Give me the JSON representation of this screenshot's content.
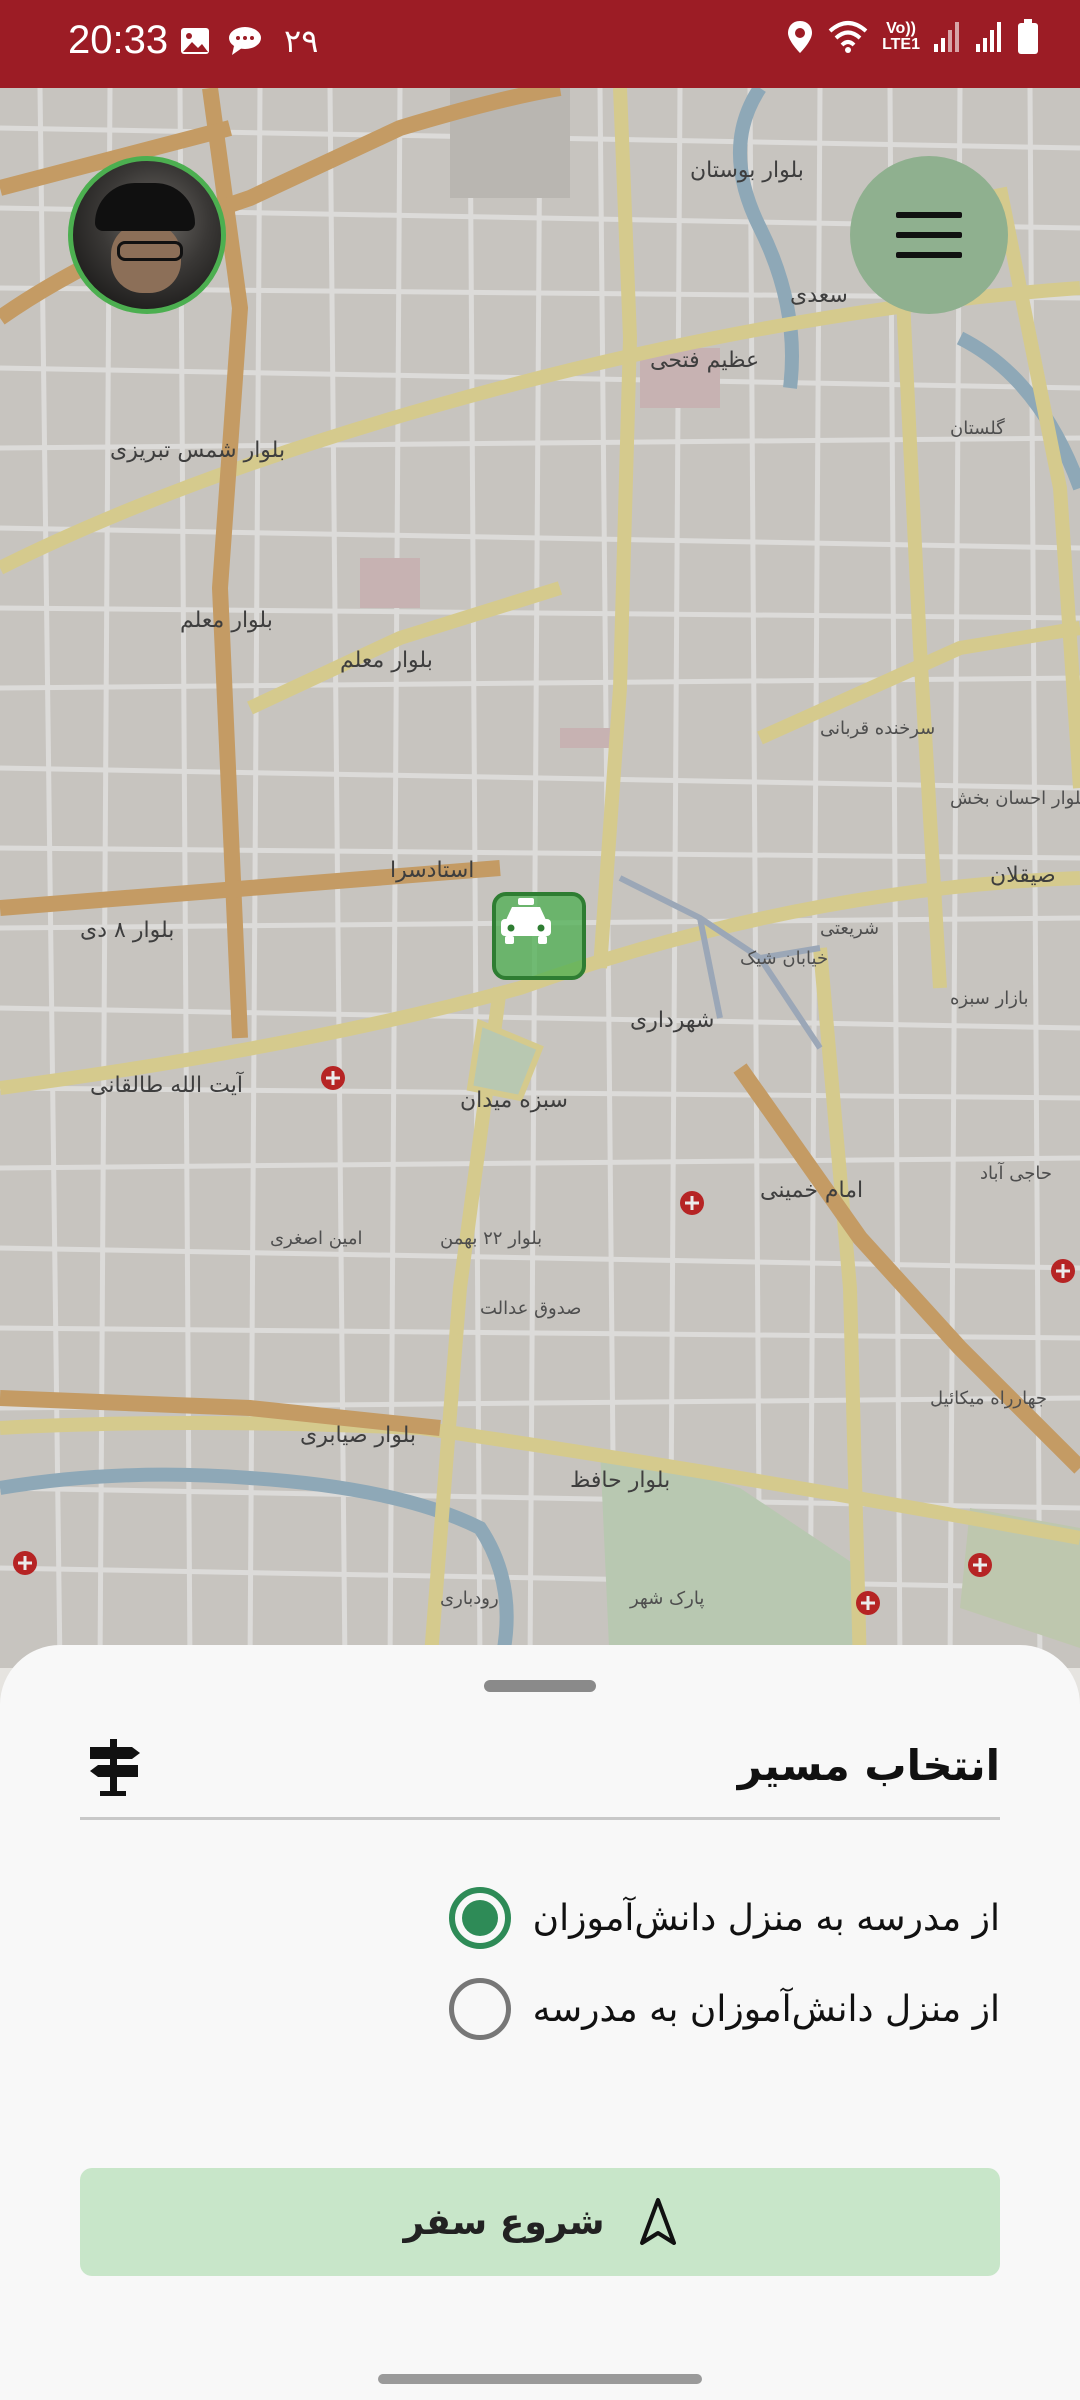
{
  "status_bar": {
    "time": "20:33",
    "notification_count": "۲۹",
    "network_label_top": "Vo))",
    "network_label_bottom": "LTE1",
    "background_color": "#9c1c25"
  },
  "map": {
    "labels": [
      "بلوار معلم",
      "بلوار شمس تبریزی",
      "بلوار ۸ دی",
      "آیت الله طالقانی",
      "سعدی",
      "عظیم فتحی",
      "بلوار بوستان",
      "سرخنده قربانی",
      "بلوار احسان بخش",
      "صیقلان",
      "شهرداری",
      "سبزه میدان",
      "بلوار ۲۲ بهمن",
      "امام خمینی",
      "بلوار حافظ",
      "بلوار صیابری",
      "پارک شهر",
      "رودباری",
      "گلستان",
      "خیابان شیک",
      "شریعتی",
      "استادسرا",
      "بلوار معلم",
      "جهارراه میکائیل",
      "امین اصغری",
      "صدوق عدالت",
      "بازار سبزه",
      "حاجی آباد"
    ],
    "icons": [
      "taxi-marker-icon"
    ],
    "accent_color": "#4caf50"
  },
  "menu": {
    "icon": "hamburger-menu-icon"
  },
  "sheet": {
    "title": "انتخاب مسیر",
    "title_icon": "signpost-icon",
    "options": [
      {
        "label": "از مدرسه به منزل دانش‌آموزان",
        "selected": true
      },
      {
        "label": "از منزل دانش‌آموزان به مدرسه",
        "selected": false
      }
    ],
    "start_button_label": "شروع سفر",
    "start_button_icon": "navigation-arrow-icon",
    "start_button_color": "#c8e6c9",
    "radio_color": "#2e8b57"
  }
}
